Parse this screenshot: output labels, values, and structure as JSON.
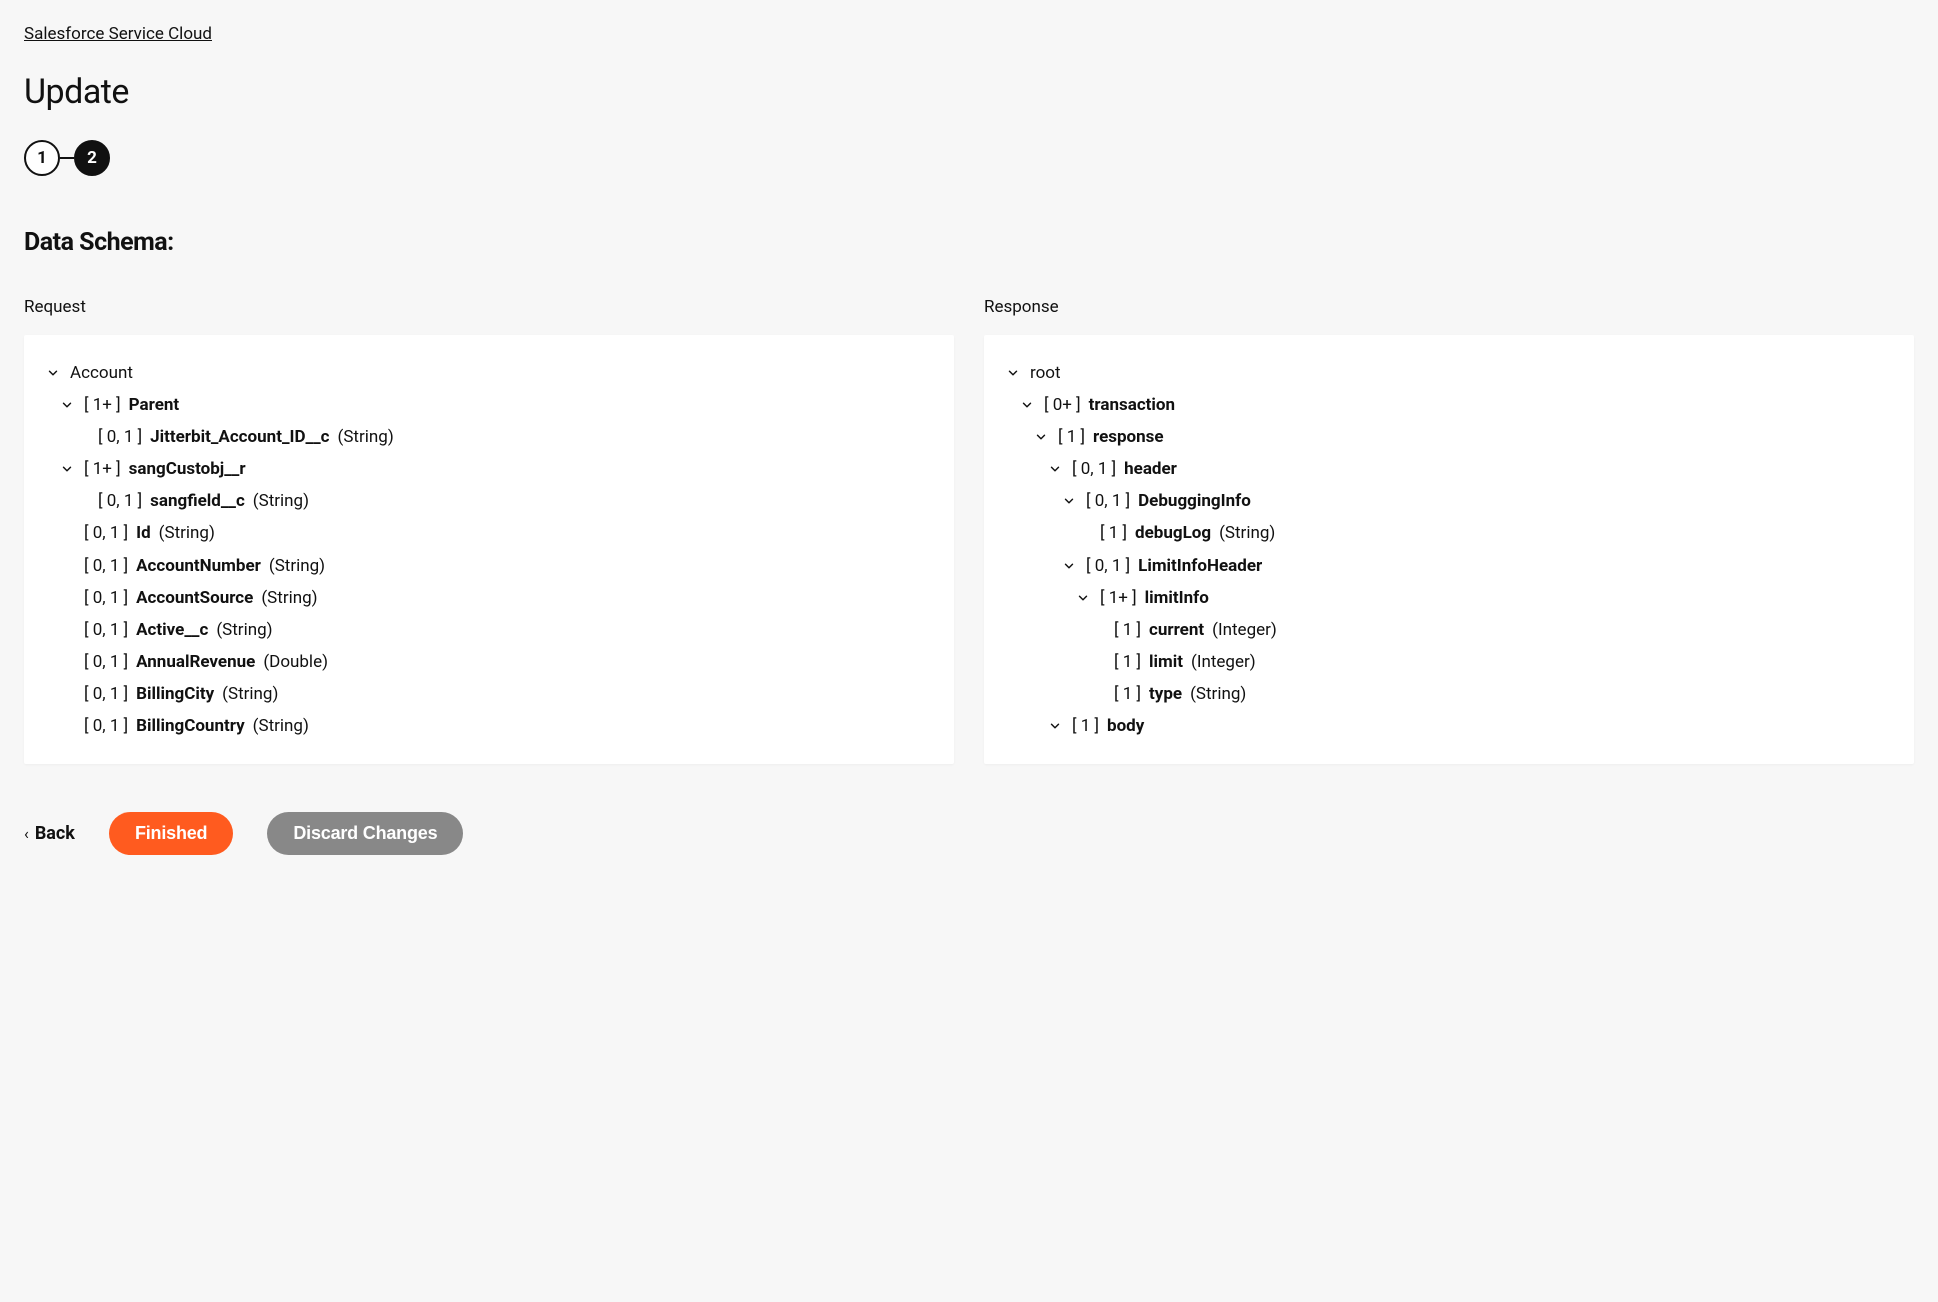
{
  "breadcrumb": "Salesforce Service Cloud",
  "page_title": "Update",
  "stepper": {
    "step1": "1",
    "step2": "2"
  },
  "section_heading": "Data Schema:",
  "request_label": "Request",
  "response_label": "Response",
  "request_tree": {
    "root": {
      "name": "Account"
    },
    "parent": {
      "card": "[ 1+ ]",
      "name": "Parent"
    },
    "jitterbit": {
      "card": "[ 0, 1 ]",
      "name": "Jitterbit_Account_ID__c",
      "type": "(String)"
    },
    "sangcustobj": {
      "card": "[ 1+ ]",
      "name": "sangCustobj__r"
    },
    "sangfield": {
      "card": "[ 0, 1 ]",
      "name": "sangfield__c",
      "type": "(String)"
    },
    "id": {
      "card": "[ 0, 1 ]",
      "name": "Id",
      "type": "(String)"
    },
    "accountnumber": {
      "card": "[ 0, 1 ]",
      "name": "AccountNumber",
      "type": "(String)"
    },
    "accountsource": {
      "card": "[ 0, 1 ]",
      "name": "AccountSource",
      "type": "(String)"
    },
    "active": {
      "card": "[ 0, 1 ]",
      "name": "Active__c",
      "type": "(String)"
    },
    "annualrevenue": {
      "card": "[ 0, 1 ]",
      "name": "AnnualRevenue",
      "type": "(Double)"
    },
    "billingcity": {
      "card": "[ 0, 1 ]",
      "name": "BillingCity",
      "type": "(String)"
    },
    "billingcountry": {
      "card": "[ 0, 1 ]",
      "name": "BillingCountry",
      "type": "(String)"
    }
  },
  "response_tree": {
    "root": {
      "name": "root"
    },
    "transaction": {
      "card": "[ 0+ ]",
      "name": "transaction"
    },
    "response": {
      "card": "[ 1 ]",
      "name": "response"
    },
    "header": {
      "card": "[ 0, 1 ]",
      "name": "header"
    },
    "debugginginfo": {
      "card": "[ 0, 1 ]",
      "name": "DebuggingInfo"
    },
    "debuglog": {
      "card": "[ 1 ]",
      "name": "debugLog",
      "type": "(String)"
    },
    "limitinfoheader": {
      "card": "[ 0, 1 ]",
      "name": "LimitInfoHeader"
    },
    "limitinfo": {
      "card": "[ 1+ ]",
      "name": "limitInfo"
    },
    "current": {
      "card": "[ 1 ]",
      "name": "current",
      "type": "(Integer)"
    },
    "limit": {
      "card": "[ 1 ]",
      "name": "limit",
      "type": "(Integer)"
    },
    "type": {
      "card": "[ 1 ]",
      "name": "type",
      "type": "(String)"
    },
    "body": {
      "card": "[ 1 ]",
      "name": "body"
    }
  },
  "footer": {
    "back": "Back",
    "finished": "Finished",
    "discard": "Discard Changes"
  }
}
